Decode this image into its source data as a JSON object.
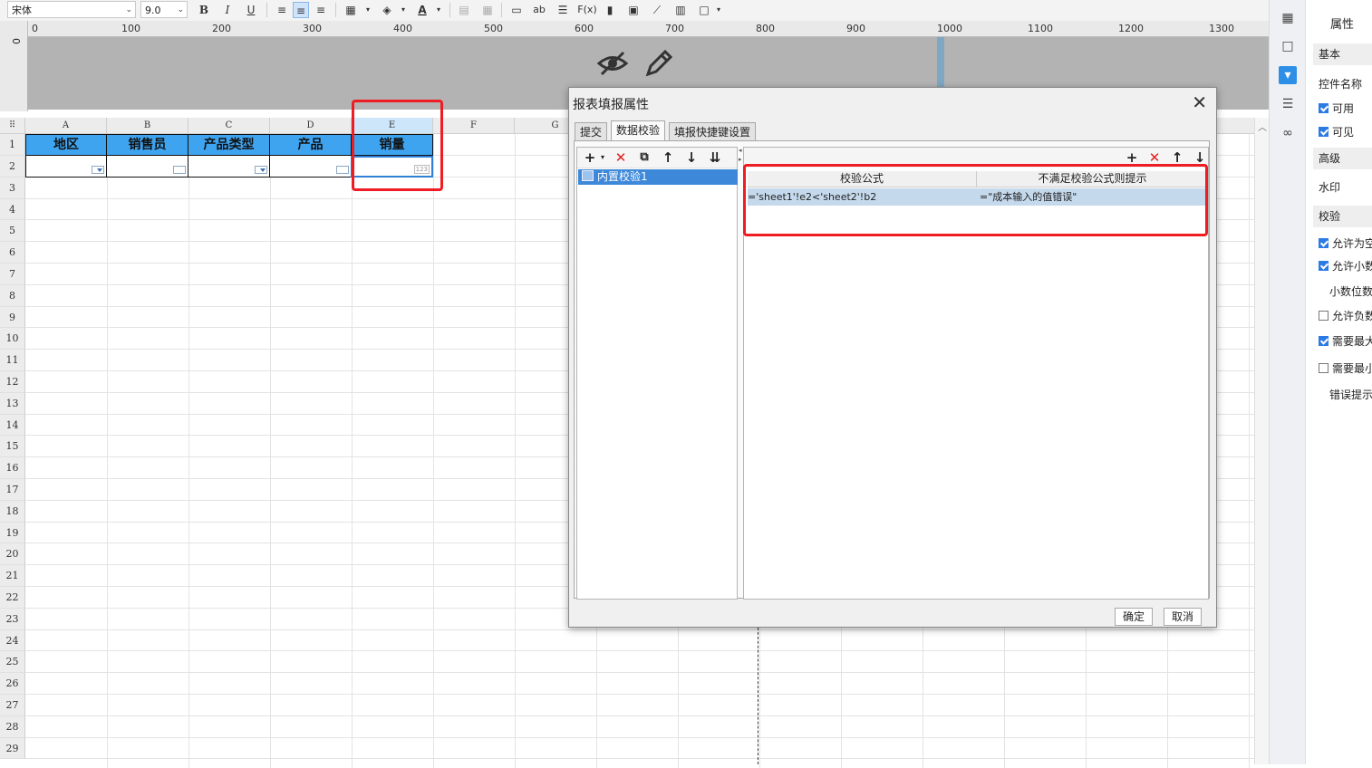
{
  "toolbar": {
    "font_name": "宋体",
    "font_size": "9.0",
    "bold": "B",
    "italic": "I",
    "underline": "U",
    "text_color_glyph": "A",
    "icons": [
      "align-left-icon",
      "align-center-icon",
      "align-right-icon",
      "border-icon",
      "fill-color-icon",
      "text-color-icon",
      "merge-icon",
      "split-icon",
      "insert-icon",
      "text-ab-icon",
      "wrap-icon",
      "formula-icon",
      "chart-icon",
      "image-icon",
      "slash-icon",
      "sheet-icon",
      "border-box-icon"
    ],
    "text_ab": "ab",
    "formula_label": "F(x)"
  },
  "ruler": {
    "ticks": [
      "0",
      "100",
      "200",
      "300",
      "400",
      "500",
      "600",
      "700",
      "800",
      "900",
      "1000",
      "1100",
      "1200",
      "1300"
    ],
    "left_label": "0"
  },
  "sheet": {
    "columns": [
      "A",
      "B",
      "C",
      "D",
      "E",
      "F",
      "G"
    ],
    "rows": [
      "1",
      "2",
      "3",
      "4",
      "5",
      "6",
      "7",
      "8",
      "9",
      "10",
      "11",
      "12",
      "13",
      "14",
      "15",
      "16",
      "17",
      "18",
      "19",
      "20",
      "21",
      "22",
      "23",
      "24",
      "25",
      "26",
      "27",
      "28",
      "29"
    ],
    "headers": [
      "地区",
      "销售员",
      "产品类型",
      "产品",
      "销量"
    ],
    "e2_widget": "123",
    "selected_column": "E"
  },
  "dialog": {
    "title": "报表填报属性",
    "close": "✕",
    "tabs": [
      "提交",
      "数据校验",
      "填报快捷键设置"
    ],
    "active_tab": "数据校验",
    "list_item": "内置校验1",
    "table_headers": [
      "校验公式",
      "不满足校验公式则提示"
    ],
    "rows": [
      {
        "formula": "='sheet1'!e2<'sheet2'!b2",
        "message": "=\"成本输入的值错误\""
      }
    ],
    "ok": "确定",
    "cancel": "取消"
  },
  "properties": {
    "title": "属性",
    "basic": "基本",
    "widget_name": "控件名称",
    "enabled": "可用",
    "visible": "可见",
    "advanced": "高级",
    "watermark": "水印",
    "validation": "校验",
    "allow_empty": "允许为空",
    "allow_decimal": "允许小数",
    "decimal_places": "小数位数",
    "allow_negative": "允许负数",
    "require_max": "需要最大",
    "require_min": "需要最小",
    "error_tip": "错误提示"
  },
  "colors": {
    "header_fill": "#3fa4f0",
    "highlight": "#ee1d23",
    "selection": "#3d88d8"
  }
}
